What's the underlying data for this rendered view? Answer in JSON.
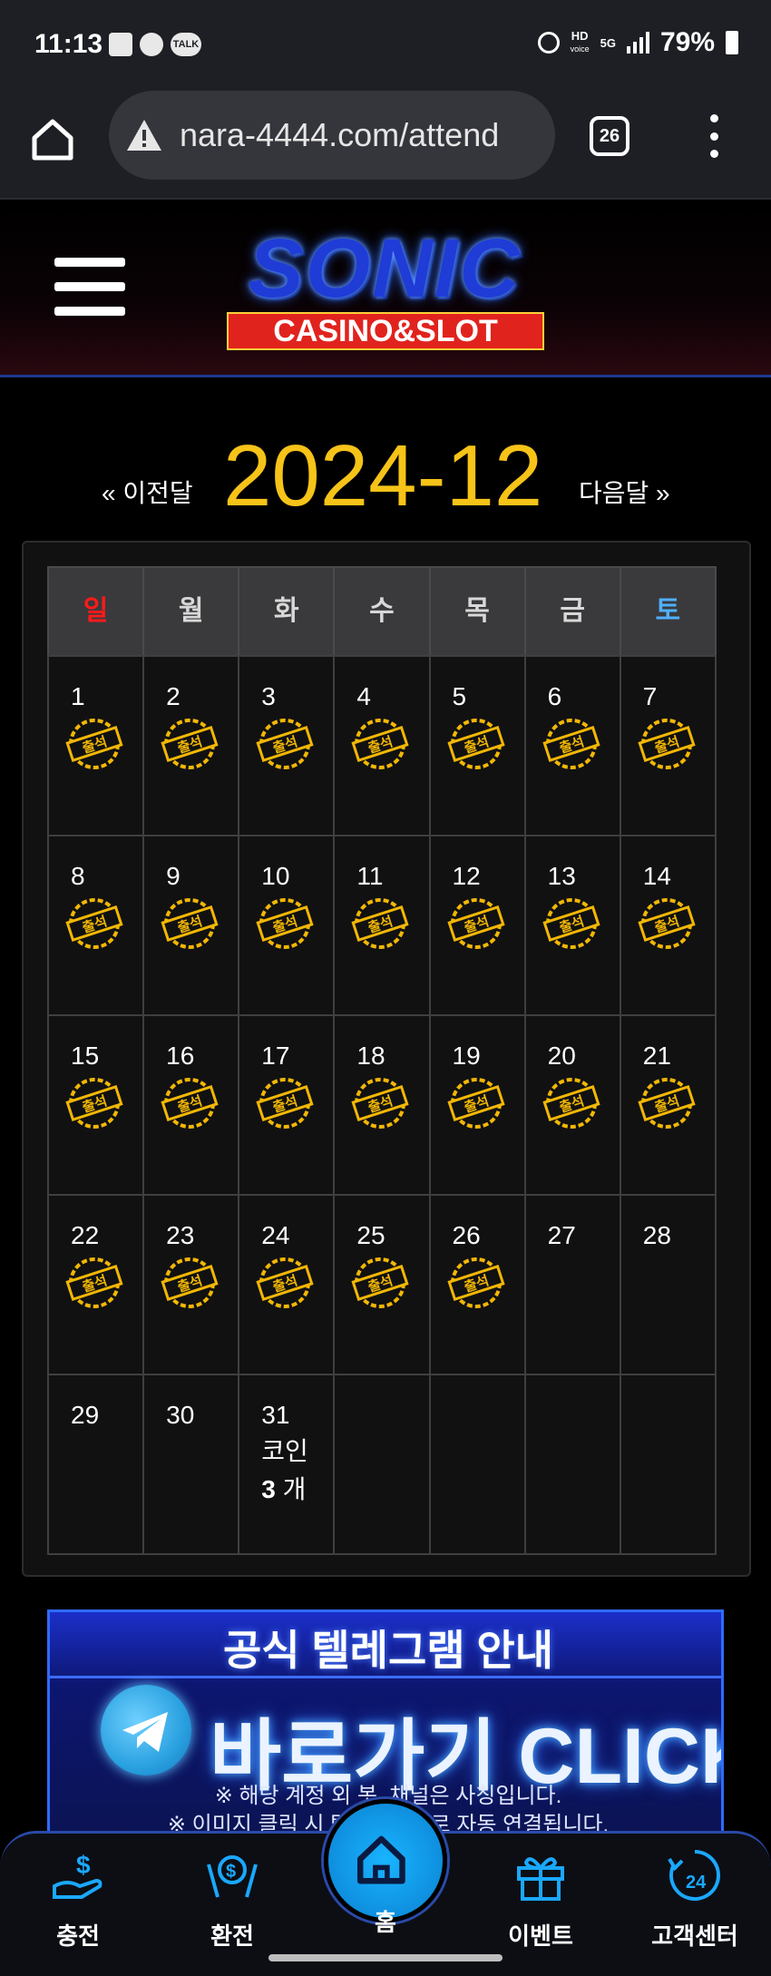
{
  "status_bar": {
    "time": "11:13",
    "hd_label": "HD",
    "voice_label": "voice",
    "network_label": "5G",
    "talk_label": "TALK",
    "battery_percent": "79%"
  },
  "browser": {
    "url": "nara-4444.com/attend",
    "tab_count": "26"
  },
  "site": {
    "logo_main": "SONIC",
    "logo_sub": "CASINO&SLOT"
  },
  "calendar": {
    "prev_label": "« 이전달",
    "month_title": "2024-12",
    "next_label": "다음달 »",
    "weekdays": [
      "일",
      "월",
      "화",
      "수",
      "목",
      "금",
      "토"
    ],
    "weeks": [
      [
        {
          "day": "1",
          "stamp": true
        },
        {
          "day": "2",
          "stamp": true
        },
        {
          "day": "3",
          "stamp": true
        },
        {
          "day": "4",
          "stamp": true
        },
        {
          "day": "5",
          "stamp": true
        },
        {
          "day": "6",
          "stamp": true
        },
        {
          "day": "7",
          "stamp": true
        }
      ],
      [
        {
          "day": "8",
          "stamp": true
        },
        {
          "day": "9",
          "stamp": true
        },
        {
          "day": "10",
          "stamp": true
        },
        {
          "day": "11",
          "stamp": true
        },
        {
          "day": "12",
          "stamp": true
        },
        {
          "day": "13",
          "stamp": true
        },
        {
          "day": "14",
          "stamp": true
        }
      ],
      [
        {
          "day": "15",
          "stamp": true
        },
        {
          "day": "16",
          "stamp": true
        },
        {
          "day": "17",
          "stamp": true
        },
        {
          "day": "18",
          "stamp": true
        },
        {
          "day": "19",
          "stamp": true
        },
        {
          "day": "20",
          "stamp": true
        },
        {
          "day": "21",
          "stamp": true
        }
      ],
      [
        {
          "day": "22",
          "stamp": true
        },
        {
          "day": "23",
          "stamp": true
        },
        {
          "day": "24",
          "stamp": true
        },
        {
          "day": "25",
          "stamp": true
        },
        {
          "day": "26",
          "stamp": true
        },
        {
          "day": "27",
          "stamp": false
        },
        {
          "day": "28",
          "stamp": false
        }
      ],
      [
        {
          "day": "29",
          "stamp": false
        },
        {
          "day": "30",
          "stamp": false
        },
        {
          "day": "31",
          "stamp": false,
          "coin_label": "코인",
          "coin_count": "3",
          "coin_unit": "개"
        },
        {
          "day": "",
          "stamp": false
        },
        {
          "day": "",
          "stamp": false
        },
        {
          "day": "",
          "stamp": false
        },
        {
          "day": "",
          "stamp": false
        }
      ]
    ],
    "stamp_text": "출석",
    "stamp_color": "#f2b705"
  },
  "banner": {
    "title": "공식 텔레그램 안내",
    "cta": "바로가기 CLICK",
    "note1": "※ 해당 계정 외 봇, 채널은 사칭입니다.",
    "note2": "※ 이미지 클릭 시 텔레그램으로 자동 연결됩니다."
  },
  "bottom_nav": {
    "deposit": "충전",
    "withdraw": "환전",
    "home": "홈",
    "event": "이벤트",
    "support": "고객센터"
  },
  "colors": {
    "accent_yellow": "#f6c318",
    "nav_blue": "#19b4ff",
    "sunday_red": "#ff1a1a",
    "saturday_blue": "#4fb0ff"
  }
}
